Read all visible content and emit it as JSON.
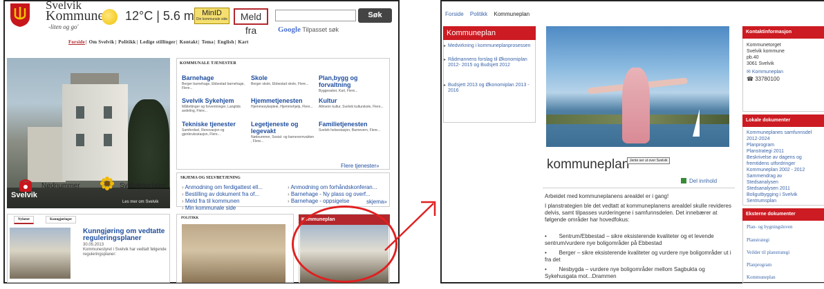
{
  "left": {
    "brand": {
      "line1": "Svelvik",
      "line2": "Kommune",
      "tagline": "-liten og go'"
    },
    "weather": {
      "text": "12°C  |  5.6 m/s"
    },
    "minid": {
      "label": "MinID",
      "sub": "Din kommunale side"
    },
    "meldfra": {
      "label": "Meld fra"
    },
    "search": {
      "button": "Søk",
      "powered": "Tilpasset søk",
      "google": "Google"
    },
    "nav": [
      "Forside",
      "Om Svelvik",
      "Politikk",
      "Ledige stillinger",
      "Kontakt",
      "Tema",
      "English",
      "Kart"
    ],
    "hero": {
      "title": "Svelvik",
      "more": "Les mer om Svelvik"
    },
    "shortcuts": [
      {
        "label": "Nødnummer"
      },
      {
        "label": "Svelvikportalen"
      }
    ],
    "services": {
      "heading": "Kommunale tjenester",
      "items": [
        {
          "name": "Barnehage",
          "desc": "Berger barnehage, Ebbestad barnehage, Flere..."
        },
        {
          "name": "Skole",
          "desc": "Berger skole, Ebbestad skole, Flere..."
        },
        {
          "name": "Plan,bygg og forvaltning",
          "desc": "Byggesaker, Kart, Flere..."
        },
        {
          "name": "Svelvik Sykehjem",
          "desc": "Måltettinger og forventninger, Langtids avdeling, Flere..."
        },
        {
          "name": "Hjemmetjenesten",
          "desc": "Hjemmesykepleie, Hjemmehjelp, Flere..."
        },
        {
          "name": "Kultur",
          "desc": "Allmenn kultur, Svelvik kulturskole, Flere..."
        },
        {
          "name": "Tekniske tjenester",
          "desc": "Samferdsel, Renovasjon og gjenbruksstasjon, Flere..."
        },
        {
          "name": "Legetjeneste og legevakt",
          "desc": "Nødnummer, Sosial- og barnevernvakten , Flere..."
        },
        {
          "name": "Familietjenesten",
          "desc": "Svelvik helsestasjon, Barnevern, Flere..."
        }
      ],
      "more": "Flere tjenester»"
    },
    "self": {
      "heading": "Skjema og selvbetjening",
      "links": [
        "Anmodning om ferdigattest ell...",
        "Bestilling av dokument fra of...",
        "Meld fra til kommunen",
        "Min kommunale side",
        "Anmodning om forhåndskonferan...",
        "Barnehage - Ny plass og overf...",
        "Barnehage - oppsigelse"
      ],
      "more": "skjema»"
    },
    "news": {
      "tabs": [
        "Nyheter",
        "Kunngjøringer"
      ],
      "title": "Kunngjøring om vedtatte reguleringsplaner",
      "date": "30.05.2013",
      "body": "Kommunestyret i Svelvik har vedtatt følgende reguleringsplaner:"
    },
    "politics": {
      "heading": "Politikk"
    },
    "plan": {
      "heading": "Kommuneplan"
    }
  },
  "right": {
    "breadcrumb": [
      "Forside",
      "Politikk",
      "Kommuneplan"
    ],
    "sidebar": {
      "heading": "Kommuneplan",
      "items": [
        "Medvirkning i kommuneplanprosessen",
        "Rådmannens forslag til Økonomiplan 2012- 2015 og Budsjett 2012",
        "Budsjett 2013 og Økonomiplan 2013 - 2016"
      ]
    },
    "title": "kommuneplan",
    "tooltip": "Jente ser ut over Svelvik",
    "share": "Del innhold",
    "body": {
      "intro": "Arbeidet med kommuneplanens arealdel er i gang!",
      "p1": "I planstrategien ble det vedtatt at kommuneplanens arealdel skulle revideres delvis, samt tilpasses vurderingene i samfunnsdelen. Det innebærer at følgende områder har hovedfokus:",
      "bullets": [
        "Sentrum/Ebbestad – sikre eksisterende kvaliteter og et levende sentrum/vurdere nye boligområder på Ebbestad",
        "Berger – sikre eksisterende kvaliteter og vurdere nye boligområder ut i fra det",
        "Nesbygda – vurdere nye boligområder mellom Sagbukta og Sykehusgata mot...Drammen"
      ]
    },
    "contact": {
      "heading": "Kontaktinformasjon",
      "lines": [
        "Kommunetorget",
        "Svelvik kommune",
        "pb.40",
        "3061 Svelvik"
      ],
      "email": "Kommuneplan",
      "phone": "33780100"
    },
    "local_docs": {
      "heading": "Lokale dokumenter",
      "items": [
        "Kommuneplanes samfunnsdel",
        "2012-2024",
        "Planprogram",
        "Planstrategi 2011",
        "Beskrivelse av dagens og",
        "fremtidens utfordringer",
        "Kommuneplan 2002 - 2012",
        "Sammendrag av",
        "Stedsanalysen",
        "Stedsanalysen 2011",
        "Boligutbygging i Svelvik",
        "Sentrumsplan"
      ]
    },
    "ext_docs": {
      "heading": "Eksterne dokumenter",
      "items": [
        "Plan- og bygningsloven",
        "Planstrategi",
        "Veilder til planstrategi",
        "Planprogram",
        "Kommuneplan"
      ]
    }
  },
  "colors": {
    "brand_red": "#cc1b22",
    "link_blue": "#3a64a8",
    "annotation_red": "#e02020"
  }
}
